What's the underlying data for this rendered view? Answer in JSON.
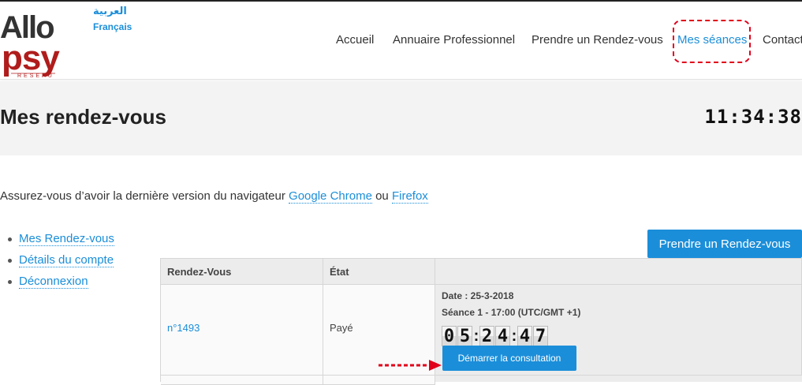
{
  "header": {
    "languages": [
      "العربية",
      "Français"
    ],
    "nav": [
      "Accueil",
      "Annuaire Professionnel",
      "Prendre un Rendez-vous",
      "Mes séances",
      "Contact"
    ],
    "active_nav": "Mes séances"
  },
  "page": {
    "title": "Mes rendez-vous",
    "clock": "11:34:38"
  },
  "notice": {
    "text_before": "Assurez-vous d’avoir la dernière version du navigateur ",
    "chrome": "Google Chrome",
    "middle": " ou ",
    "firefox": "Firefox"
  },
  "sidebar": {
    "items": [
      {
        "label": "Mes Rendez-vous"
      },
      {
        "label": "Détails du compte"
      },
      {
        "label": "Déconnexion"
      }
    ]
  },
  "actions": {
    "new_appointment": "Prendre un Rendez-vous"
  },
  "table": {
    "headers": [
      "Rendez-Vous",
      "État",
      ""
    ],
    "rows": [
      {
        "id": "n°1493",
        "status": "Payé",
        "date": "Date : 25-3-2018",
        "session": "Séance 1 - 17:00 (UTC/GMT +1)",
        "countdown": {
          "hours": "05",
          "minutes": "24",
          "seconds": "47"
        },
        "start_button": "Démarrer la consultation"
      }
    ]
  },
  "colors": {
    "accent": "#1b8ed9",
    "highlight": "#e0001a",
    "logo": "#b01c1c"
  }
}
